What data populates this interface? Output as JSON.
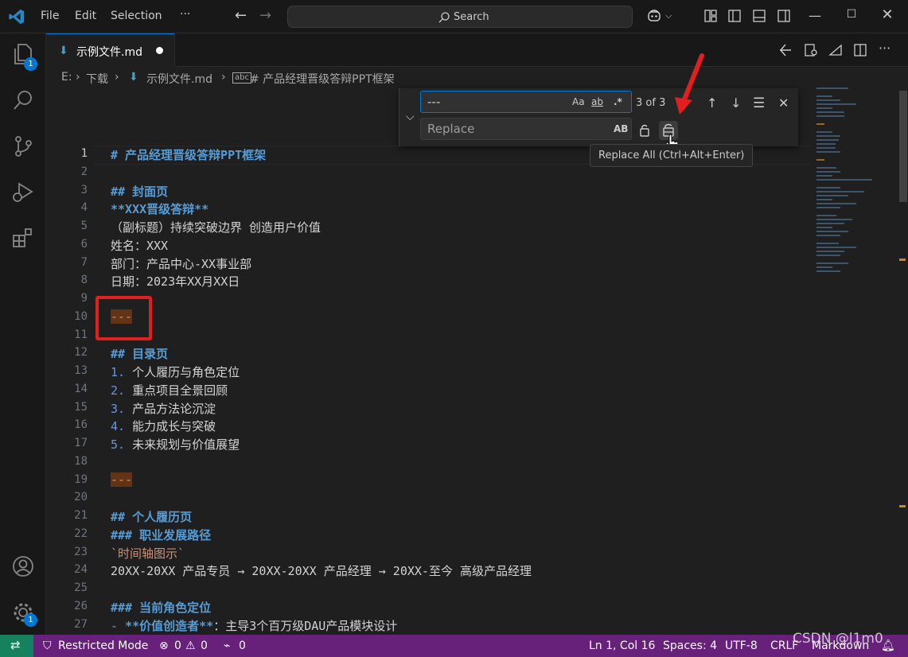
{
  "menu": {
    "file": "File",
    "edit": "Edit",
    "selection": "Selection",
    "more": "···"
  },
  "command_center": {
    "label": "Search"
  },
  "tab": {
    "name": "示例文件.md"
  },
  "breadcrumb": {
    "drive": "E:",
    "folder": "下载",
    "file": "示例文件.md",
    "symbol": "# 产品经理晋级答辩PPT框架"
  },
  "find_widget": {
    "find_value": "---",
    "replace_placeholder": "Replace",
    "match_case": "Aa",
    "whole_word": "ab",
    "regex": ".*",
    "preserve_case": "AB",
    "count": "3 of 3"
  },
  "tooltip": {
    "text": "Replace All (Ctrl+Alt+Enter)"
  },
  "badges": {
    "explorer": "1",
    "settings": "1"
  },
  "editor": {
    "lines": [
      {
        "n": "1",
        "segments": [
          {
            "t": "# 产品经理晋级答辩PPT框架",
            "c": "h"
          }
        ]
      },
      {
        "n": "2",
        "segments": []
      },
      {
        "n": "3",
        "segments": [
          {
            "t": "## 封面页",
            "c": "h"
          }
        ]
      },
      {
        "n": "4",
        "segments": [
          {
            "t": "**XXX晋级答辩**",
            "c": "bold"
          }
        ]
      },
      {
        "n": "5",
        "segments": [
          {
            "t": "（副标题）持续突破边界 创造用户价值",
            "c": "plain"
          }
        ]
      },
      {
        "n": "6",
        "segments": [
          {
            "t": "姓名：XXX",
            "c": "plain"
          }
        ]
      },
      {
        "n": "7",
        "segments": [
          {
            "t": "部门：产品中心-XX事业部",
            "c": "plain"
          }
        ]
      },
      {
        "n": "8",
        "segments": [
          {
            "t": "日期：2023年XX月XX日",
            "c": "plain"
          }
        ]
      },
      {
        "n": "9",
        "segments": []
      },
      {
        "n": "10",
        "segments": [
          {
            "t": "---",
            "c": "hr-match"
          }
        ]
      },
      {
        "n": "11",
        "segments": []
      },
      {
        "n": "12",
        "segments": [
          {
            "t": "## 目录页",
            "c": "h"
          }
        ]
      },
      {
        "n": "13",
        "segments": [
          {
            "t": "1. ",
            "c": "listnum"
          },
          {
            "t": "个人履历与角色定位",
            "c": "plain"
          }
        ]
      },
      {
        "n": "14",
        "segments": [
          {
            "t": "2. ",
            "c": "listnum"
          },
          {
            "t": "重点项目全景回顾",
            "c": "plain"
          }
        ]
      },
      {
        "n": "15",
        "segments": [
          {
            "t": "3. ",
            "c": "listnum"
          },
          {
            "t": "产品方法论沉淀",
            "c": "plain"
          }
        ]
      },
      {
        "n": "16",
        "segments": [
          {
            "t": "4. ",
            "c": "listnum"
          },
          {
            "t": "能力成长与突破",
            "c": "plain"
          }
        ]
      },
      {
        "n": "17",
        "segments": [
          {
            "t": "5. ",
            "c": "listnum"
          },
          {
            "t": "未来规划与价值展望",
            "c": "plain"
          }
        ]
      },
      {
        "n": "18",
        "segments": []
      },
      {
        "n": "19",
        "segments": [
          {
            "t": "---",
            "c": "hr-match"
          }
        ]
      },
      {
        "n": "20",
        "segments": []
      },
      {
        "n": "21",
        "segments": [
          {
            "t": "## 个人履历页",
            "c": "h"
          }
        ]
      },
      {
        "n": "22",
        "segments": [
          {
            "t": "### 职业发展路径",
            "c": "h"
          }
        ]
      },
      {
        "n": "23",
        "segments": [
          {
            "t": "`时间轴图示`",
            "c": "codes"
          }
        ]
      },
      {
        "n": "24",
        "segments": [
          {
            "t": "20XX-20XX 产品专员 → 20XX-20XX 产品经理 → 20XX-至今 高级产品经理",
            "c": "plain"
          }
        ]
      },
      {
        "n": "25",
        "segments": []
      },
      {
        "n": "26",
        "segments": [
          {
            "t": "### 当前角色定位",
            "c": "h"
          }
        ]
      },
      {
        "n": "27",
        "segments": [
          {
            "t": "- ",
            "c": "listnum"
          },
          {
            "t": "**价值创造者**",
            "c": "bold"
          },
          {
            "t": "：主导3个百万级DAU产品模块设计",
            "c": "plain"
          }
        ]
      }
    ]
  },
  "status": {
    "restricted": "Restricted Mode",
    "errors": "0",
    "warnings": "0",
    "ports": "0",
    "position": "Ln 1, Col 16",
    "spaces": "Spaces: 4",
    "encoding": "UTF-8",
    "eol": "CRLF",
    "language": "Markdown"
  },
  "watermark": "CSDN @l1m0",
  "colors": {
    "accent": "#0078d4",
    "status_bar": "#68217a",
    "remote": "#16825d",
    "annotation": "#e0201f",
    "heading": "#569cd6",
    "match": "#623315"
  }
}
